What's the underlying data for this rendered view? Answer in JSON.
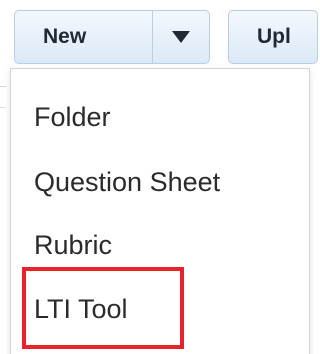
{
  "toolbar": {
    "new_label": "New",
    "dropdown_arrow_icon": "caret-down-icon",
    "upload_label": "Upl"
  },
  "menu": {
    "items": [
      {
        "label": "Folder"
      },
      {
        "label": "Question Sheet"
      },
      {
        "label": "Rubric"
      },
      {
        "label": "LTI Tool"
      }
    ],
    "highlighted_item": "LTI Tool"
  },
  "colors": {
    "highlight": "#e8232e",
    "button_border": "#b8cfe3",
    "button_text": "#1f2a36",
    "menu_text": "#2b2b2b"
  }
}
